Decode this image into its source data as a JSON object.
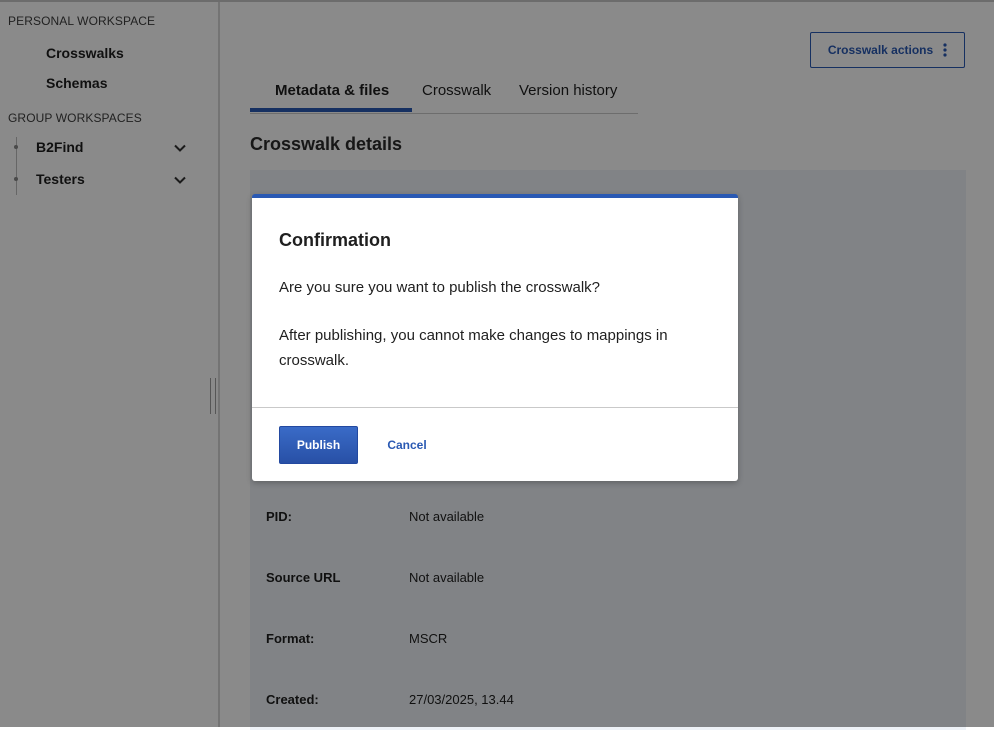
{
  "sidebar": {
    "personal_title": "PERSONAL WORKSPACE",
    "personal_items": [
      "Crosswalks",
      "Schemas"
    ],
    "group_title": "GROUP WORKSPACES",
    "group_items": [
      "B2Find",
      "Testers"
    ]
  },
  "header": {
    "actions_label": "Crosswalk actions"
  },
  "tabs": [
    "Metadata & files",
    "Crosswalk",
    "Version history"
  ],
  "section_title": "Crosswalk details",
  "details": [
    {
      "label": "PID:",
      "value": "Not available"
    },
    {
      "label": "Source URL",
      "value": "Not available"
    },
    {
      "label": "Format:",
      "value": "MSCR"
    },
    {
      "label": "Created:",
      "value": "27/03/2025, 13.44"
    }
  ],
  "modal": {
    "title": "Confirmation",
    "question": "Are you sure you want to publish the crosswalk?",
    "note": "After publishing, you cannot make changes to mappings in crosswalk.",
    "publish_label": "Publish",
    "cancel_label": "Cancel"
  },
  "colors": {
    "accent": "#2a59b3",
    "overlay": "rgba(0,0,0,0.46)"
  }
}
